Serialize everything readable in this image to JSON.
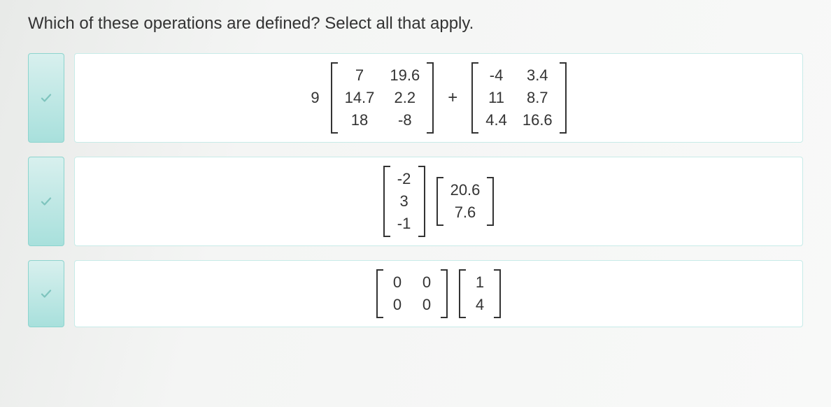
{
  "question": "Which of these operations are defined? Select all that apply.",
  "options": [
    {
      "checked": true,
      "expression": {
        "scalar": "9",
        "matrixA": {
          "rows": 3,
          "cols": 2,
          "cells": [
            "7",
            "19.6",
            "14.7",
            "2.2",
            "18",
            "-8"
          ]
        },
        "operator": "+",
        "matrixB": {
          "rows": 3,
          "cols": 2,
          "cells": [
            "-4",
            "3.4",
            "11",
            "8.7",
            "4.4",
            "16.6"
          ]
        }
      }
    },
    {
      "checked": true,
      "expression": {
        "matrixA": {
          "rows": 3,
          "cols": 1,
          "cells": [
            "-2",
            "3",
            "-1"
          ]
        },
        "matrixB": {
          "rows": 2,
          "cols": 1,
          "cells": [
            "20.6",
            "7.6"
          ]
        }
      }
    },
    {
      "checked": true,
      "expression": {
        "matrixA": {
          "rows": 2,
          "cols": 2,
          "cells": [
            "0",
            "0",
            "0",
            "0"
          ]
        },
        "matrixB": {
          "rows": 2,
          "cols": 1,
          "cells": [
            "1",
            "4"
          ]
        }
      }
    }
  ]
}
